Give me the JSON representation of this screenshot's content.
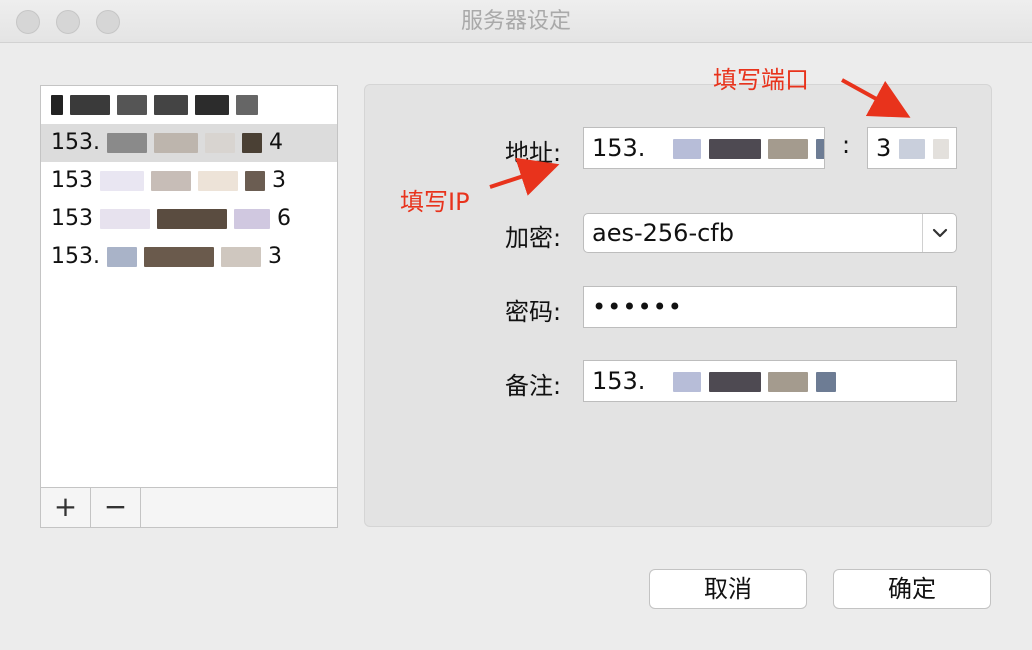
{
  "window": {
    "title": "服务器设定"
  },
  "server_list": {
    "items": [
      {
        "label": ""
      },
      {
        "label": "153.",
        "tail": "4"
      },
      {
        "label": "153",
        "tail": "3"
      },
      {
        "label": "153",
        "tail": "6"
      },
      {
        "label": "153.",
        "tail": "3"
      }
    ],
    "add_label": "+",
    "remove_label": "−"
  },
  "form": {
    "address_label": "地址:",
    "address_value": "153.",
    "port_separator": ":",
    "port_value": "3",
    "encryption_label": "加密:",
    "encryption_value": "aes-256-cfb",
    "password_label": "密码:",
    "password_value": "••••••",
    "remark_label": "备注:",
    "remark_value": "153."
  },
  "annotations": {
    "ip_hint": "填写IP",
    "port_hint": "填写端口"
  },
  "buttons": {
    "cancel": "取消",
    "ok": "确定"
  },
  "colors": {
    "annotation": "#e8331c",
    "selected_row": "#dcdcdc"
  }
}
